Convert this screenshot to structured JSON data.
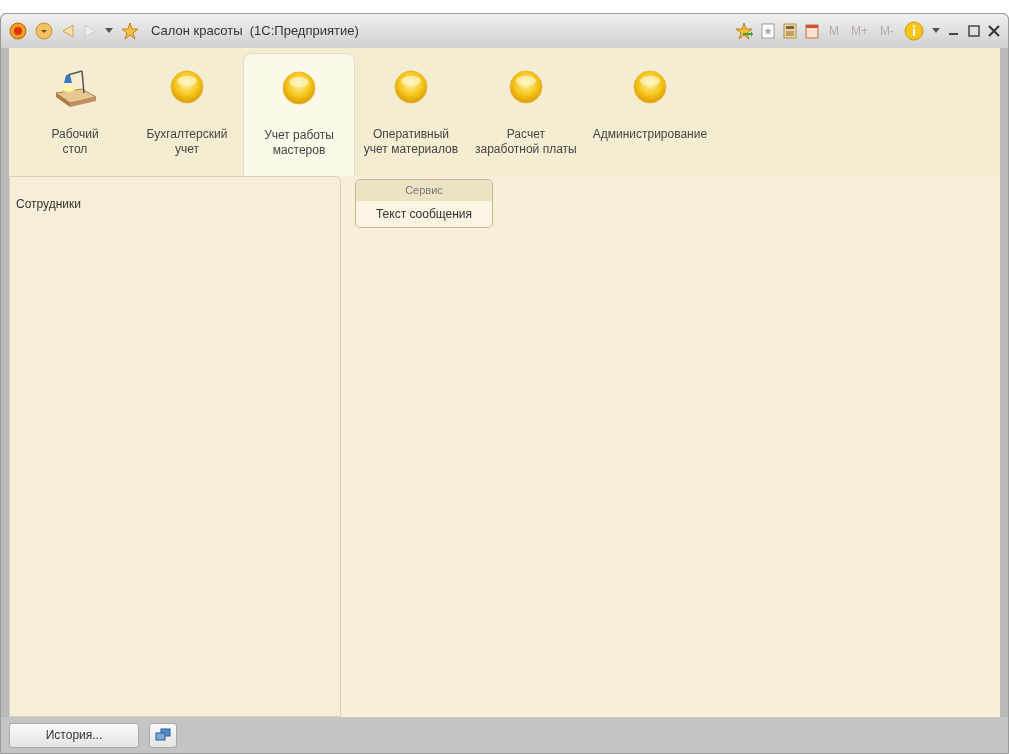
{
  "window": {
    "title": "Салон красоты  (1С:Предприятие)",
    "memory_buttons": [
      "M",
      "M+",
      "M-"
    ]
  },
  "sections": [
    {
      "kind": "desktop",
      "label": "Рабочий\nстол",
      "selected": false
    },
    {
      "kind": "section",
      "label": "Бухгалтерский\nучет",
      "selected": false
    },
    {
      "kind": "section",
      "label": "Учет работы\nмастеров",
      "selected": true
    },
    {
      "kind": "section",
      "label": "Оперативный\nучет материалов",
      "selected": false
    },
    {
      "kind": "section",
      "label": "Расчет\nзаработной платы",
      "selected": false
    },
    {
      "kind": "section",
      "label": "Администрирование",
      "selected": false
    }
  ],
  "navigation_panel": {
    "items": [
      "Сотрудники"
    ]
  },
  "actions_panel": {
    "group": "Сервис",
    "items": [
      "Текст сообщения"
    ]
  },
  "status_bar": {
    "history_button": "История..."
  }
}
